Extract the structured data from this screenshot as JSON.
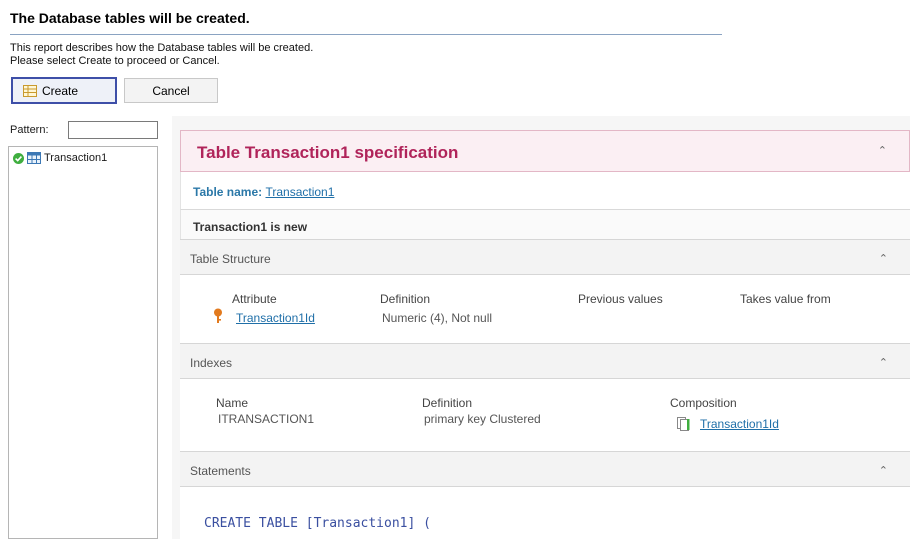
{
  "header": {
    "title": "The Database tables will be created.",
    "description_line1": "This report describes how the Database tables will be created.",
    "description_line2": "Please select Create to proceed or Cancel."
  },
  "toolbar": {
    "create_label": "Create",
    "cancel_label": "Cancel"
  },
  "sidebar": {
    "pattern_label": "Pattern:",
    "pattern_value": "",
    "items": [
      {
        "label": "Transaction1"
      }
    ]
  },
  "spec": {
    "title": "Table Transaction1 specification",
    "table_name_label": "Table name:",
    "table_name_value": "Transaction1",
    "status": "Transaction1 is new"
  },
  "table_structure": {
    "title": "Table Structure",
    "columns": [
      "Attribute",
      "Definition",
      "Previous values",
      "Takes value from"
    ],
    "rows": [
      {
        "attribute": "Transaction1Id",
        "definition": "Numeric (4), Not null",
        "previous": "",
        "takes_from": ""
      }
    ]
  },
  "indexes": {
    "title": "Indexes",
    "columns": [
      "Name",
      "Definition",
      "Composition"
    ],
    "rows": [
      {
        "name": "ITRANSACTION1",
        "definition": "primary key Clustered",
        "composition": "Transaction1Id"
      }
    ]
  },
  "statements": {
    "title": "Statements",
    "line1": "CREATE TABLE [Transaction1] ("
  },
  "colors": {
    "accent_title": "#b0245a",
    "link": "#1f6fa8",
    "create_border": "#3e4fa8"
  }
}
